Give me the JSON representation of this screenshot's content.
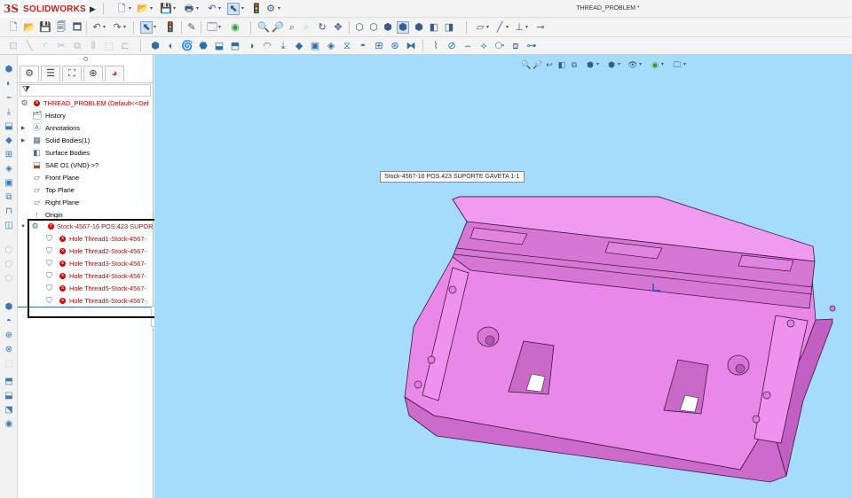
{
  "app": {
    "logo_ds": "3S",
    "logo_name": "SOLIDWORKS",
    "document_title": "THREAD_PROBLEM *"
  },
  "toolbars": {
    "row1": [
      "new-icon",
      "open-icon",
      "save-icon",
      "print-icon",
      "undo-icon",
      "select-icon",
      "rebuild-icon",
      "file-properties-icon",
      "options-icon",
      "sketch-icon",
      "smart-dimension-icon",
      "appearance-icon",
      "zoom-icon",
      "rotate-icon",
      "view-orientation-icon",
      "display-style-icon",
      "hide-show-icon",
      "section-view-icon",
      "measure-icon",
      "reference-geometry-icon"
    ],
    "row2": [
      "sketch-tools-icon",
      "extrude-icon",
      "revolve-icon",
      "sweep-icon",
      "loft-icon",
      "fillet-icon",
      "chamfer-icon",
      "shell-icon",
      "rib-icon",
      "draft-icon",
      "hole-wizard-icon",
      "pattern-icon",
      "mirror-icon",
      "curves-icon",
      "instant3d-icon"
    ]
  },
  "feature_tree": {
    "tabs": [
      "feature-manager",
      "property-manager",
      "configuration-manager",
      "dimxpert-manager",
      "display-manager"
    ],
    "root": {
      "label": "THREAD_PROBLEM  (Default<<Def",
      "error": true
    },
    "items": [
      {
        "label": "History",
        "icon": "history-icon",
        "expandable": false
      },
      {
        "label": "Annotations",
        "icon": "annotations-icon",
        "expandable": true
      },
      {
        "label": "Solid Bodies(1)",
        "icon": "solid-bodies-icon",
        "expandable": true
      },
      {
        "label": "Surface Bodies",
        "icon": "surface-bodies-icon",
        "expandable": false
      },
      {
        "label": "SAE O1 (VND)->?",
        "icon": "material-icon",
        "expandable": false
      },
      {
        "label": "Front Plane",
        "icon": "plane-icon",
        "expandable": false
      },
      {
        "label": "Top Plane",
        "icon": "plane-icon",
        "expandable": false
      },
      {
        "label": "Right Plane",
        "icon": "plane-icon",
        "expandable": false
      },
      {
        "label": "Origin",
        "icon": "origin-icon",
        "expandable": false
      }
    ],
    "stock": {
      "label": "Stock-4567-16 POS.423 SUPOR",
      "error": true
    },
    "holes": [
      "Hole Thread1-Stock-4567-",
      "Hole Thread2-Stock-4567-",
      "Hole Thread3-Stock-4567-",
      "Hole Thread4-Stock-4567-",
      "Hole Thread5-Stock-4567-",
      "Hole Thread6-Stock-4567-"
    ]
  },
  "viewport": {
    "tooltip": "Stock-4567-16 POS.423 SUPORTE GAVETA 1-1",
    "background_color": "#a6dcfb",
    "part_color": "#ea88ea"
  }
}
